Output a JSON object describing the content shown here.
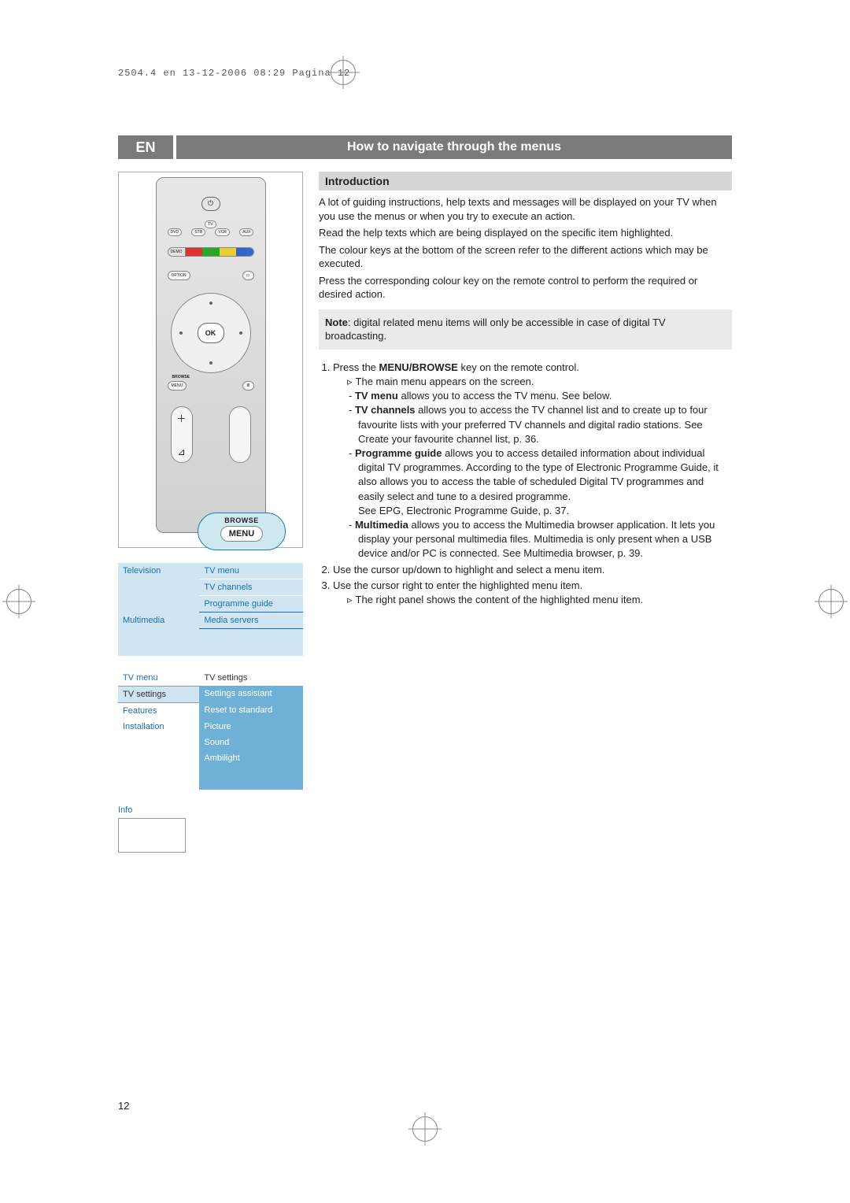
{
  "header_meta": "2504.4 en  13-12-2006  08:29  Pagina 12",
  "lang": "EN",
  "title": "How to navigate through the menus",
  "section_header": "Introduction",
  "intro_paragraphs": [
    "A lot of guiding instructions, help texts and messages will be displayed on your TV when you use the menus or when you try to execute an action.",
    "Read the help texts which are being displayed on the specific item highlighted.",
    "The colour keys at the bottom of the screen refer to the different actions which may be executed.",
    "Press the corresponding colour key on the remote control to perform the required or desired action."
  ],
  "note_label": "Note",
  "note_text": ": digital related menu items will only be accessible in case of digital TV broadcasting.",
  "steps": {
    "s1": "Press the ",
    "s1_bold": "MENU/BROWSE",
    "s1_after": " key on the remote control.",
    "s1_sub": "The main menu appears on the screen.",
    "tv_menu_b": "TV menu",
    "tv_menu_t": " allows you to access the TV menu. See below.",
    "tv_ch_b": "TV channels",
    "tv_ch_t": " allows you to access the TV channel list and to create up to four favourite lists with your preferred TV channels and digital radio stations. See Create your favourite channel list, p. 36.",
    "pg_b": "Programme guide",
    "pg_t": " allows you to access detailed information about individual digital TV programmes. According to the type of Electronic Programme Guide, it also allows you to access the table of scheduled Digital TV programmes and easily select and tune to a desired programme.",
    "pg_see": "See EPG, Electronic Programme Guide, p. 37.",
    "mm_b": "Multimedia",
    "mm_t": " allows you to access the Multimedia browser application. It lets you display your personal multimedia files. Multimedia is only present when a USB device and/or PC is connected. See Multimedia browser, p. 39.",
    "s2": "Use the cursor up/down to highlight and select a menu item.",
    "s3": "Use the cursor right to enter the highlighted menu item.",
    "s3_sub": "The right panel shows the content of the highlighted menu item."
  },
  "remote": {
    "power": "⏻",
    "tv": "TV",
    "dvd": "DVD",
    "stb": "STB",
    "vcr": "VCR",
    "aux": "AUX",
    "demo": "DEMO",
    "option": "OPTION",
    "guide_icon": "⌂",
    "ok": "OK",
    "browse": "BROWSE",
    "menu": "MENU",
    "plus": "＋",
    "vol": "⊿"
  },
  "callout": {
    "browse": "BROWSE",
    "menu": "MENU"
  },
  "menu1": {
    "left1": "Television",
    "r1": "TV menu",
    "r2": "TV channels",
    "r3": "Programme guide",
    "left2": "Multimedia",
    "r4": "Media servers"
  },
  "menu2": {
    "left1": "TV menu",
    "r1": "TV settings",
    "left2": "TV settings",
    "r2": "Settings assistant",
    "left3": "Features",
    "r3": "Reset to standard",
    "left4": "Installation",
    "r4": "Picture",
    "r5": "Sound",
    "r6": "Ambilight"
  },
  "info_label": "Info",
  "page_number": "12"
}
